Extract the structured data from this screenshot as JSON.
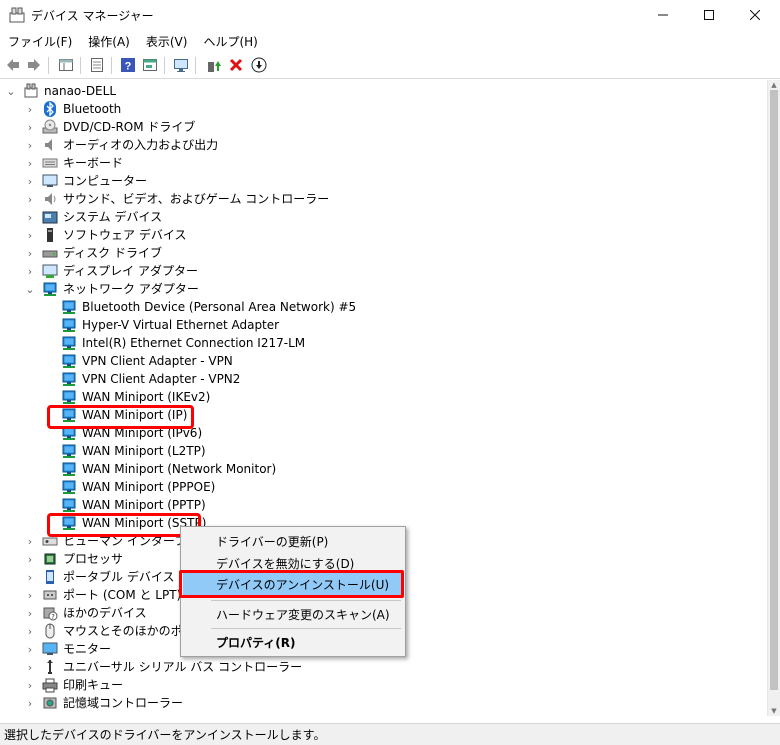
{
  "window": {
    "title": "デバイス マネージャー"
  },
  "menu": [
    "ファイル(F)",
    "操作(A)",
    "表示(V)",
    "ヘルプ(H)"
  ],
  "tree": {
    "root": "nanao-DELL",
    "categories_top": [
      {
        "label": "Bluetooth",
        "icon": "bluetooth-icon"
      },
      {
        "label": "DVD/CD-ROM ドライブ",
        "icon": "dvd-drive-icon"
      },
      {
        "label": "オーディオの入力および出力",
        "icon": "speaker-icon"
      },
      {
        "label": "キーボード",
        "icon": "keyboard-icon"
      },
      {
        "label": "コンピューター",
        "icon": "computer-icon"
      },
      {
        "label": "サウンド、ビデオ、およびゲーム コントローラー",
        "icon": "sound-icon"
      },
      {
        "label": "システム デバイス",
        "icon": "system-device-icon"
      },
      {
        "label": "ソフトウェア デバイス",
        "icon": "software-device-icon"
      },
      {
        "label": "ディスク ドライブ",
        "icon": "disk-drive-icon"
      },
      {
        "label": "ディスプレイ アダプター",
        "icon": "display-adapter-icon"
      }
    ],
    "network": {
      "label": "ネットワーク アダプター",
      "children": [
        "Bluetooth Device (Personal Area Network) #5",
        "Hyper-V Virtual Ethernet Adapter",
        "Intel(R) Ethernet Connection I217-LM",
        "VPN Client Adapter - VPN",
        "VPN Client Adapter - VPN2",
        "WAN Miniport (IKEv2)",
        "WAN Miniport (IP)",
        "WAN Miniport (IPv6)",
        "WAN Miniport (L2TP)",
        "WAN Miniport (Network Monitor)",
        "WAN Miniport (PPPOE)",
        "WAN Miniport (PPTP)",
        "WAN Miniport (SSTP)"
      ]
    },
    "categories_bottom": [
      {
        "label": "ヒューマン インターフェイス デバイス",
        "icon": "hid-icon"
      },
      {
        "label": "プロセッサ",
        "icon": "processor-icon"
      },
      {
        "label": "ポータブル デバイス",
        "icon": "portable-device-icon"
      },
      {
        "label": "ポート (COM と LPT)",
        "icon": "port-icon"
      },
      {
        "label": "ほかのデバイス",
        "icon": "other-device-icon"
      },
      {
        "label": "マウスとそのほかのポインティング デバイス",
        "icon": "mouse-icon"
      },
      {
        "label": "モニター",
        "icon": "monitor-icon"
      },
      {
        "label": "ユニバーサル シリアル バス コントローラー",
        "icon": "usb-icon"
      },
      {
        "label": "印刷キュー",
        "icon": "printer-icon"
      },
      {
        "label": "記憶域コントローラー",
        "icon": "storage-controller-icon"
      }
    ]
  },
  "context_menu": {
    "update": "ドライバーの更新(P)",
    "disable": "デバイスを無効にする(D)",
    "uninstall": "デバイスのアンインストール(U)",
    "scan": "ハードウェア変更のスキャン(A)",
    "properties": "プロパティ(R)"
  },
  "status": "選択したデバイスのドライバーをアンインストールします。",
  "colors": {
    "highlight": "#ff0000",
    "menu_selected": "#91c9f7",
    "network_icon": "#1e88d8"
  }
}
